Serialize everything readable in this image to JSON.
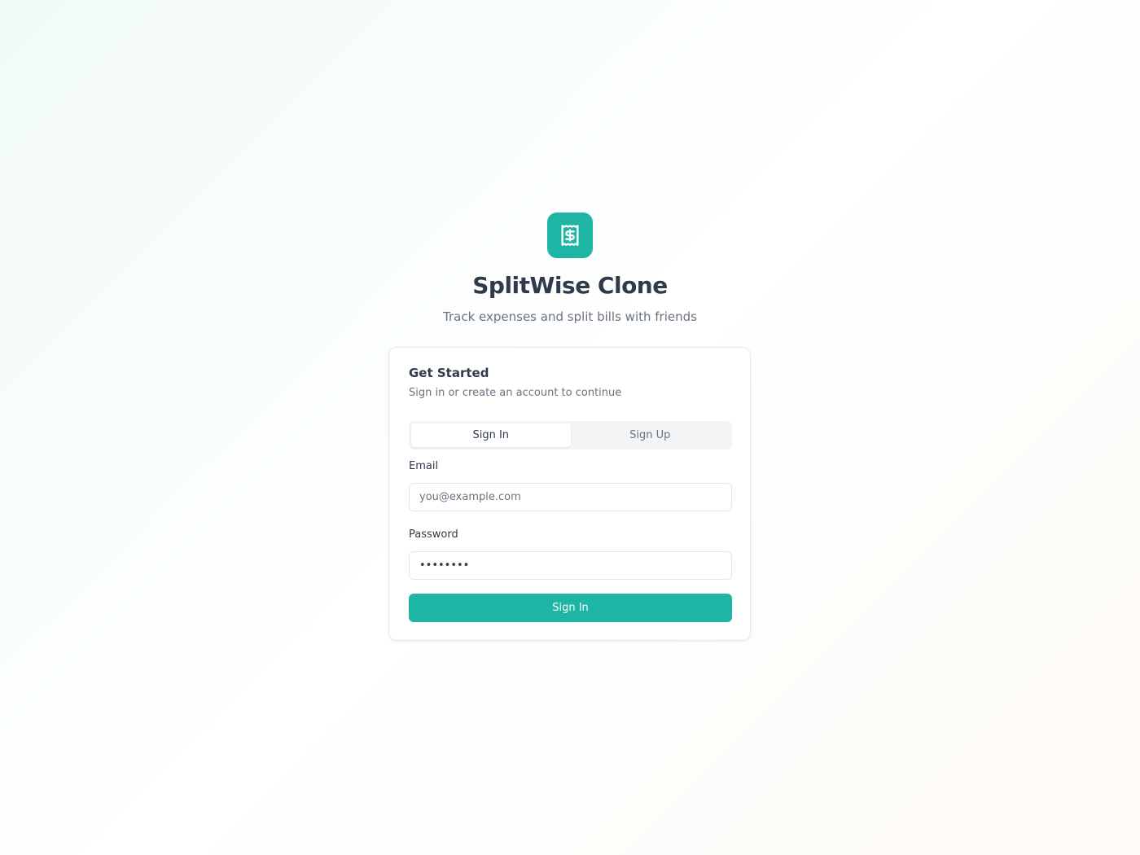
{
  "app": {
    "title": "SplitWise Clone",
    "subtitle": "Track expenses and split bills with friends",
    "logo_icon": "receipt-dollar-icon",
    "accent_color": "#1fb5a4"
  },
  "card": {
    "title": "Get Started",
    "description": "Sign in or create an account to continue"
  },
  "tabs": [
    {
      "label": "Sign In",
      "active": true
    },
    {
      "label": "Sign Up",
      "active": false
    }
  ],
  "form": {
    "email_label": "Email",
    "email_placeholder": "you@example.com",
    "email_value": "",
    "password_label": "Password",
    "password_value": "••••••••",
    "submit_label": "Sign In"
  }
}
